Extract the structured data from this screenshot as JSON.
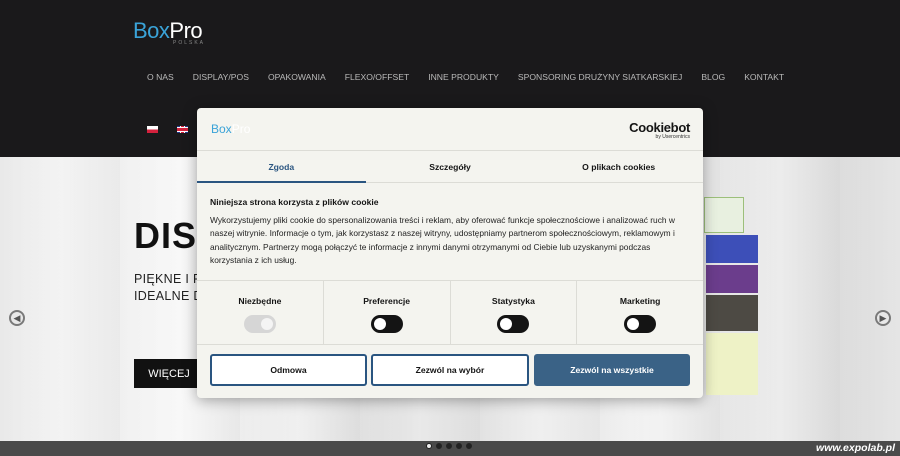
{
  "site": {
    "logo_box": "Box",
    "logo_pro": "Pro",
    "logo_sub": "POLSKA",
    "nav": [
      "O NAS",
      "DISPLAY/POS",
      "OPAKOWANIA",
      "FLEXO/OFFSET",
      "INNE PRODUKTY",
      "SPONSORING DRUŻYNY SIATKARSKIEJ",
      "BLOG",
      "KONTAKT"
    ],
    "languages": [
      "pl",
      "en"
    ]
  },
  "hero": {
    "title": "DIS",
    "subtitle_line1": "PIĘKNE I PR",
    "subtitle_line2": "IDEALNE DO",
    "button": "WIĘCEJ",
    "slide_count": 5,
    "active_slide": 1
  },
  "cookie_dialog": {
    "logo_box": "Box",
    "logo_pro": "Pro",
    "provider_name": "Cookiebot",
    "provider_by": "by Usercentrics",
    "tabs": [
      {
        "label": "Zgoda",
        "active": true
      },
      {
        "label": "Szczegóły",
        "active": false
      },
      {
        "label": "O plikach cookies",
        "active": false
      }
    ],
    "title": "Niniejsza strona korzysta z plików cookie",
    "body": "Wykorzystujemy pliki cookie do spersonalizowania treści i reklam, aby oferować funkcje społecznościowe i analizować ruch w naszej witrynie. Informacje o tym, jak korzystasz z naszej witryny, udostępniamy partnerom społecznościowym, reklamowym i analitycznym. Partnerzy mogą połączyć te informacje z innymi danymi otrzymanymi od Ciebie lub uzyskanymi podczas korzystania z ich usług.",
    "preferences": [
      {
        "label": "Niezbędne",
        "enabled": true,
        "locked": true
      },
      {
        "label": "Preferencje",
        "enabled": false,
        "locked": false
      },
      {
        "label": "Statystyka",
        "enabled": false,
        "locked": false
      },
      {
        "label": "Marketing",
        "enabled": false,
        "locked": false
      }
    ],
    "buttons": {
      "deny": "Odmowa",
      "allow_selection": "Zezwól na wybór",
      "allow_all": "Zezwól na wszystkie"
    }
  },
  "watermark": "www.expolab.pl",
  "colors": {
    "brand_blue": "#3aa3d8",
    "header_bg": "#1a191b",
    "accent": "#2a5580",
    "allow_all_bg": "#3a6286"
  }
}
